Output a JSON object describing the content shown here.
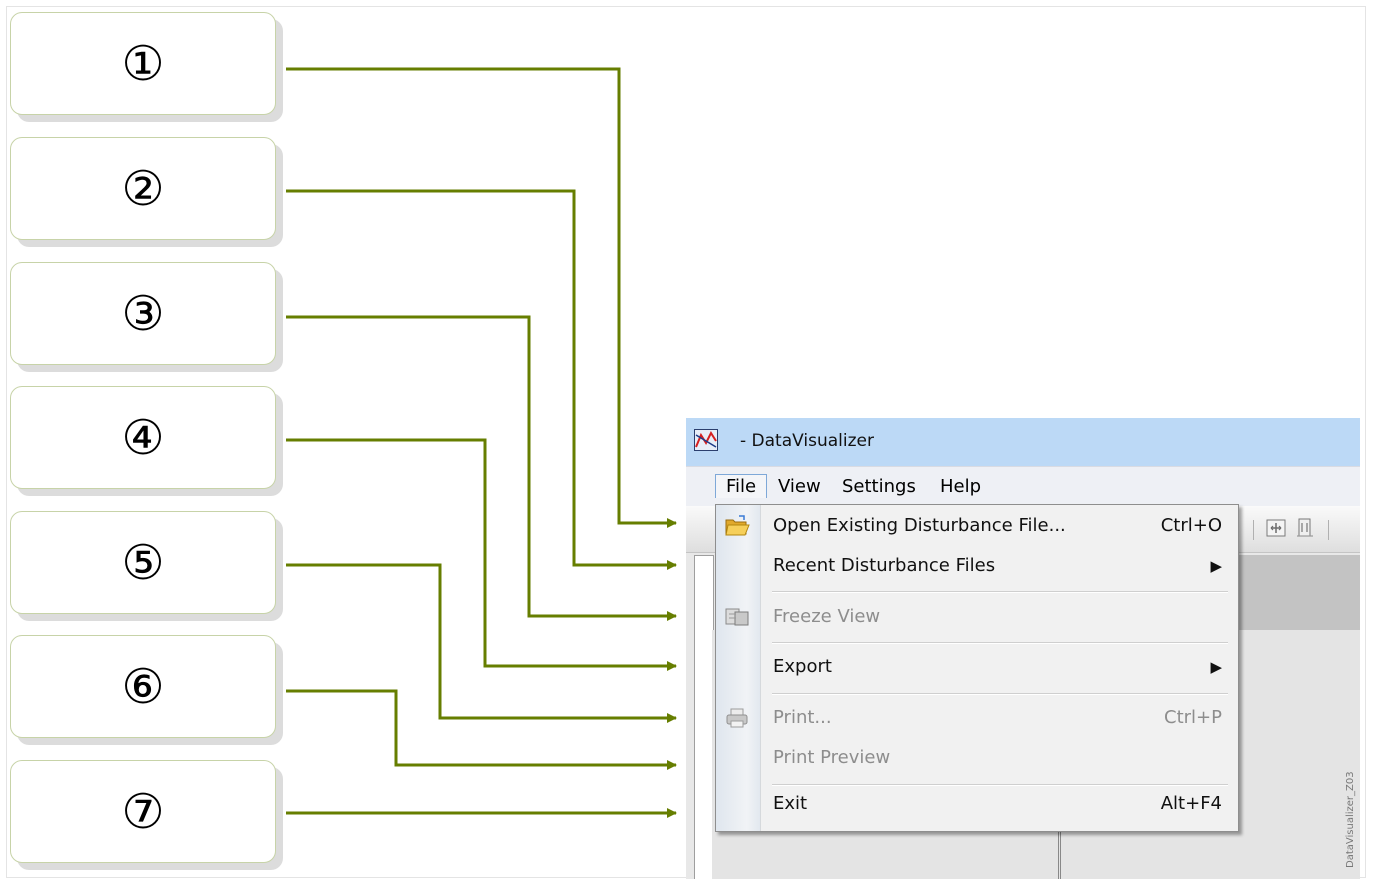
{
  "callouts": [
    "①",
    "②",
    "③",
    "④",
    "⑤",
    "⑥",
    "⑦"
  ],
  "connector_color": "#667e00",
  "window": {
    "title": "- DataVisualizer",
    "icon": "datavisualizer-app-icon"
  },
  "menubar": {
    "items": [
      "File",
      "View",
      "Settings",
      "Help"
    ],
    "active": "File"
  },
  "file_menu": {
    "items": [
      {
        "label": "Open Existing Disturbance File...",
        "shortcut": "Ctrl+O",
        "icon": "open-folder-icon",
        "enabled": true
      },
      {
        "label": "Recent Disturbance Files",
        "submenu": true,
        "enabled": true
      },
      {
        "label": "Freeze View",
        "icon": "freeze-view-icon",
        "enabled": false
      },
      {
        "label": "Export",
        "submenu": true,
        "enabled": true
      },
      {
        "label": "Print...",
        "shortcut": "Ctrl+P",
        "icon": "printer-icon",
        "enabled": false
      },
      {
        "label": "Print Preview",
        "enabled": false
      },
      {
        "label": "Exit",
        "shortcut": "Alt+F4",
        "enabled": true
      }
    ],
    "submenu_arrow": "▶"
  },
  "watermark": "DataVisualizer_Z03"
}
